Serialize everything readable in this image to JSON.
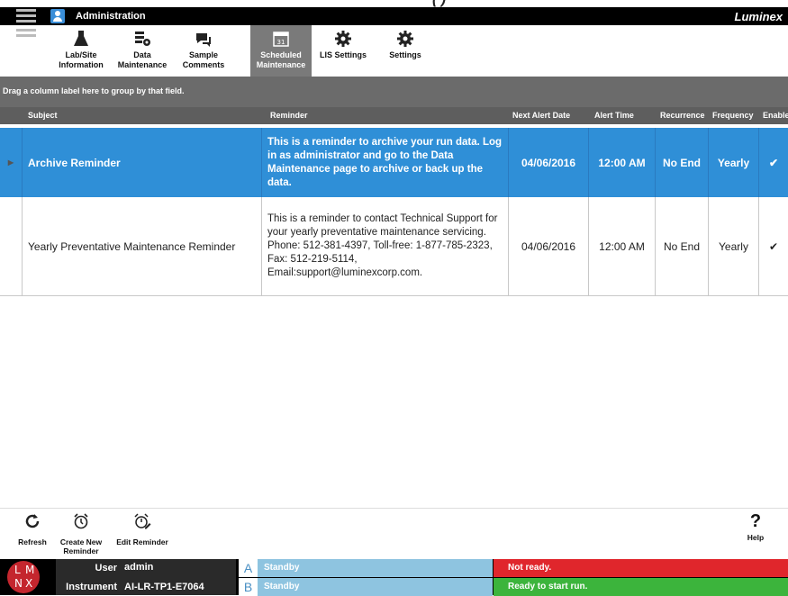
{
  "caption": "(                         )",
  "app": {
    "title": "Administration",
    "brand": "Luminex"
  },
  "tabs": [
    {
      "label": "Lab/Site Information",
      "icon": "flask-icon",
      "active": false
    },
    {
      "label": "Data Maintenance",
      "icon": "data-maintenance-icon",
      "active": false
    },
    {
      "label": "Sample Comments",
      "icon": "comments-icon",
      "active": false
    },
    {
      "label": "Scheduled Maintenance",
      "icon": "calendar-icon",
      "active": true
    },
    {
      "label": "LIS Settings",
      "icon": "gear-icon",
      "active": false
    },
    {
      "label": "Settings",
      "icon": "gear-icon",
      "active": false
    }
  ],
  "grid": {
    "group_hint": "Drag a column label here to group by that field.",
    "columns": [
      "Subject",
      "Reminder",
      "Next Alert Date",
      "Alert Time",
      "Recurrence",
      "Frequency",
      "Enabled"
    ],
    "rows": [
      {
        "subject": "Archive Reminder",
        "reminder": "This is a reminder to archive your run data. Log in as administrator and go to the Data Maintenance page to archive or back up the data.",
        "next_alert_date": "04/06/2016",
        "alert_time": "12:00 AM",
        "recurrence": "No End",
        "frequency": "Yearly",
        "enabled": "✔"
      },
      {
        "subject": "Yearly Preventative Maintenance Reminder",
        "reminder": "This is a reminder to contact Technical Support for your yearly preventative maintenance servicing. Phone: 512-381-4397, Toll-free: 1-877-785-2323, Fax: 512-219-5114, Email:support@luminexcorp.com.",
        "next_alert_date": "04/06/2016",
        "alert_time": "12:00 AM",
        "recurrence": "No End",
        "frequency": "Yearly",
        "enabled": "✔"
      }
    ]
  },
  "bottom_toolbar": {
    "refresh": "Refresh",
    "create": "Create New Reminder",
    "edit": "Edit Reminder",
    "help": "Help"
  },
  "status": {
    "logo_letters": [
      "L",
      "M",
      "N",
      "X"
    ],
    "user_label": "User",
    "user_value": "admin",
    "instrument_label": "Instrument",
    "instrument_value": "AI-LR-TP1-E7064",
    "slot_a_letter": "A",
    "slot_a_text": "Standby",
    "slot_b_letter": "B",
    "slot_b_text": "Standby",
    "state_top": "Not ready.",
    "state_bottom": "Ready to start run.",
    "colors": {
      "not_ready": "#e0262c",
      "ready": "#3cb43c",
      "standby": "#8ec4e0",
      "selected_row": "#2f8fd7"
    }
  }
}
